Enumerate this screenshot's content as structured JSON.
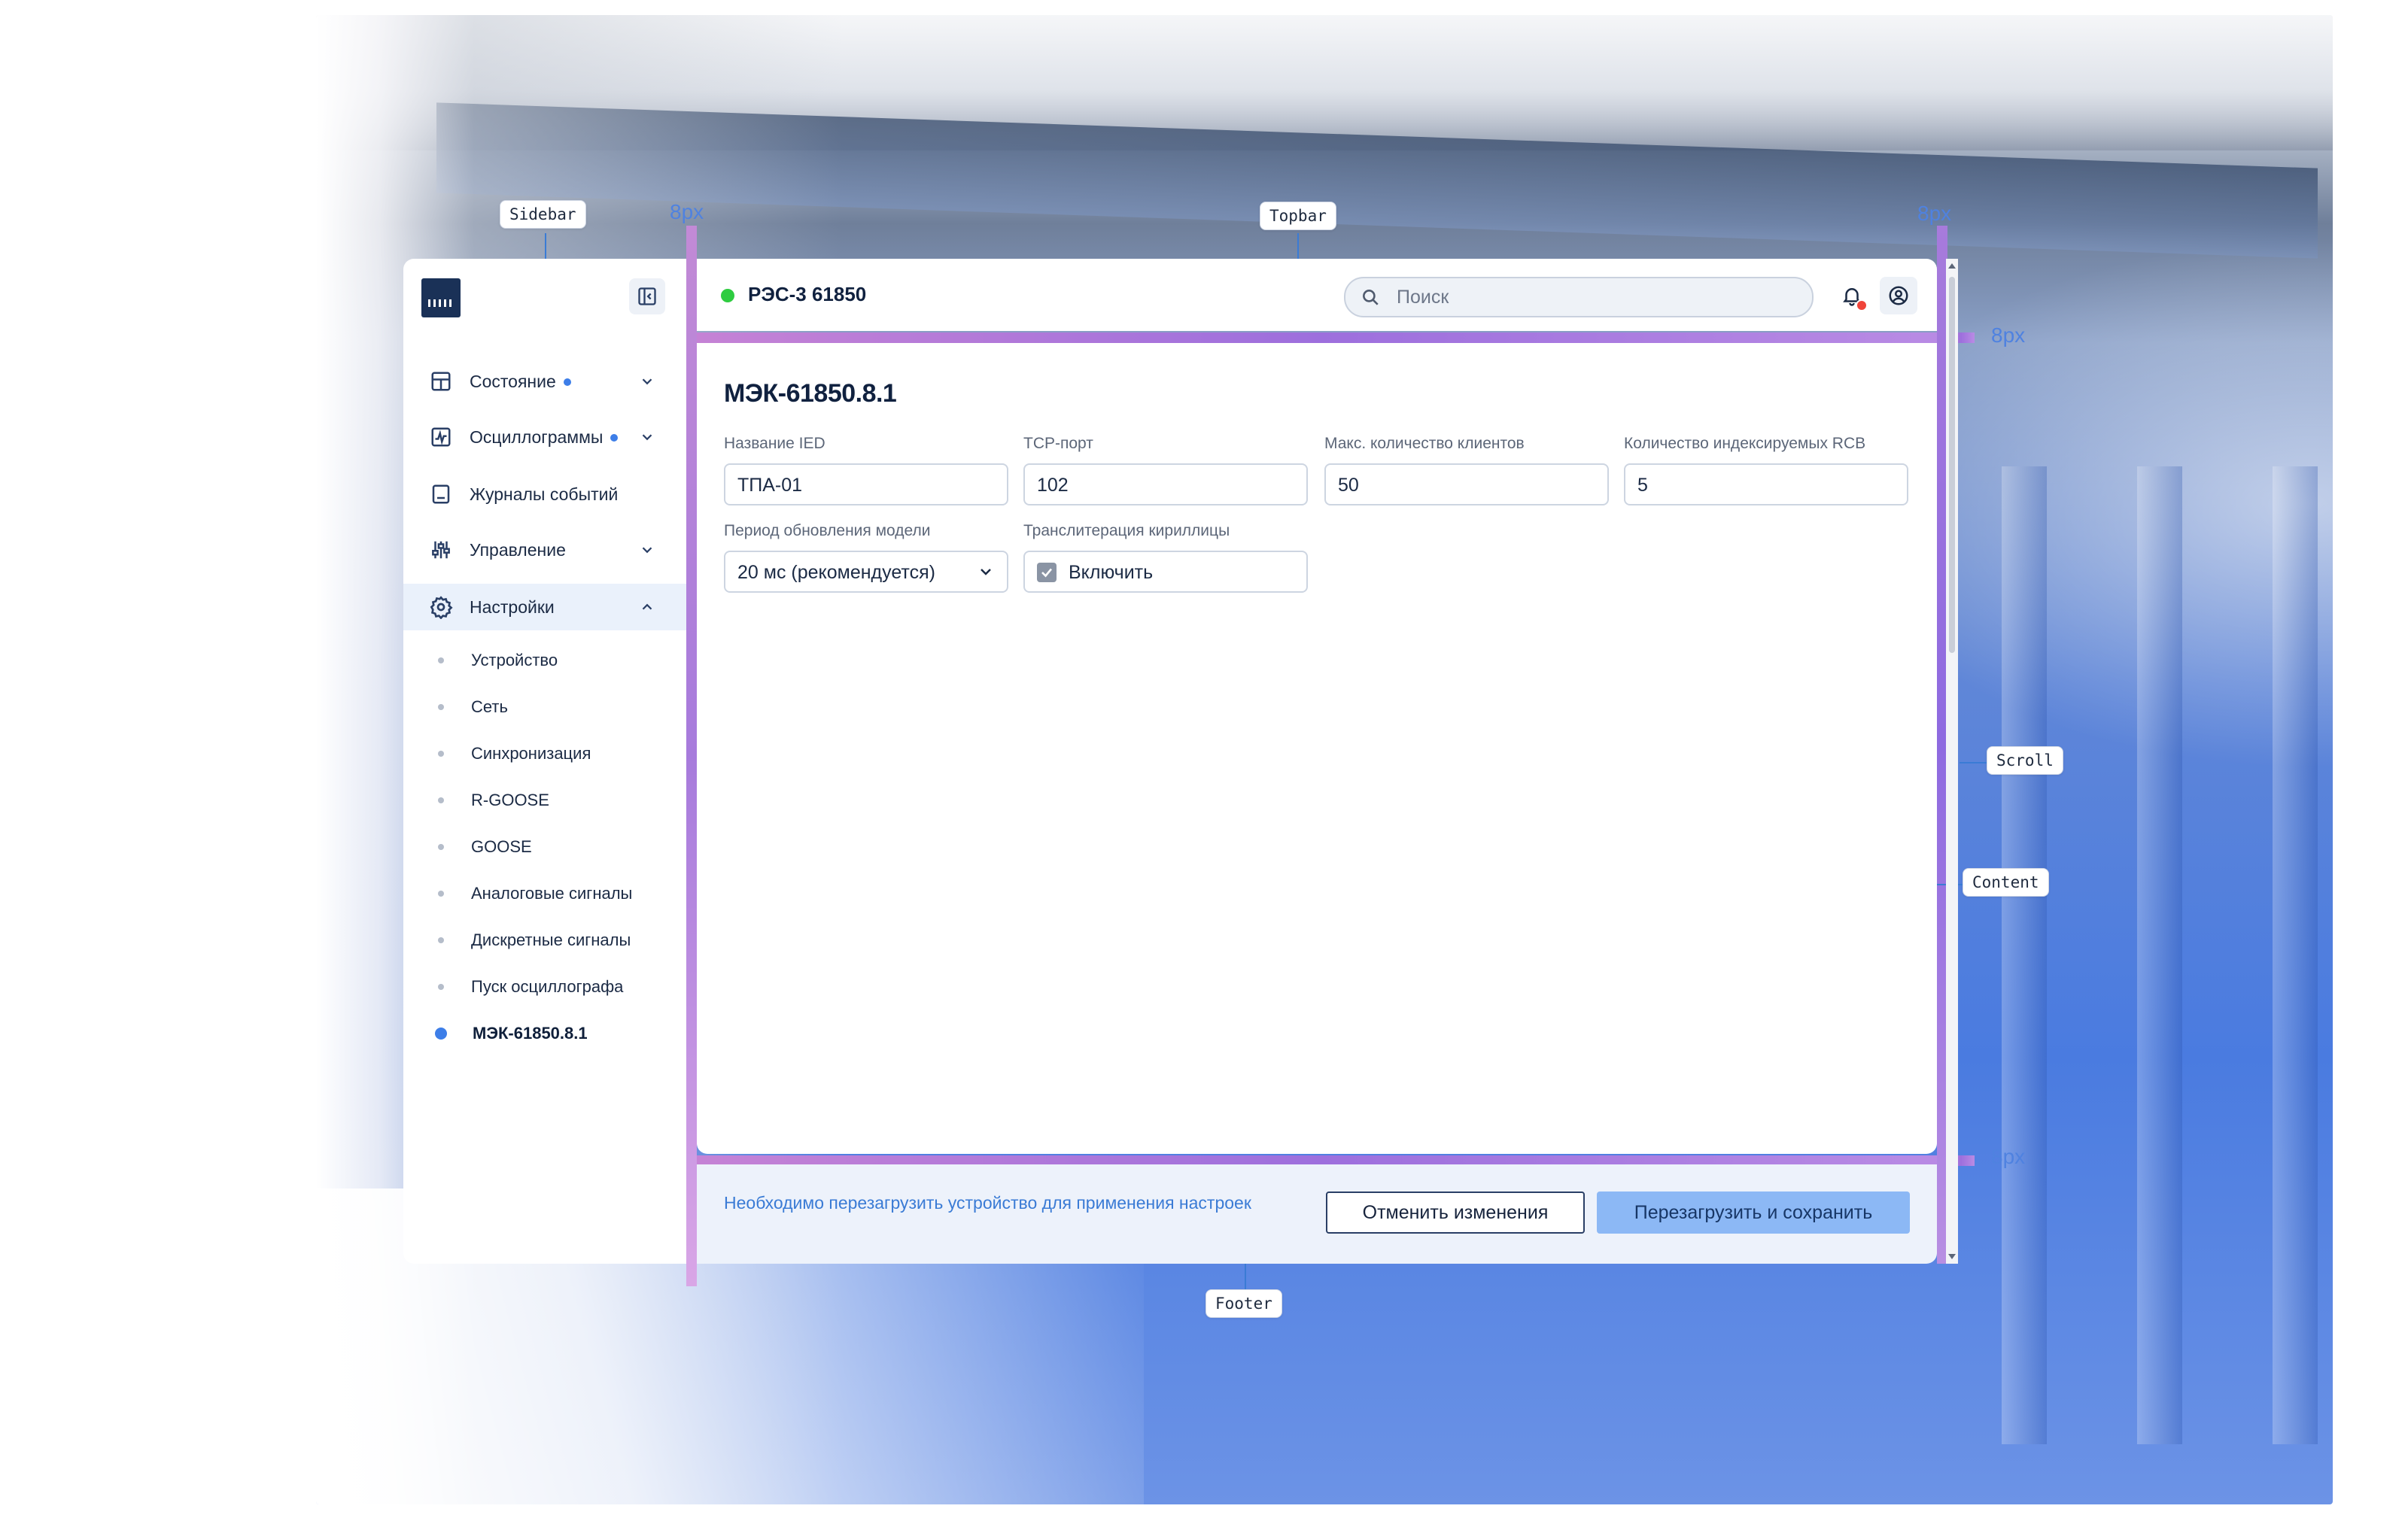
{
  "annotations": {
    "sidebar_tag": "Sidebar",
    "topbar_tag": "Topbar",
    "scroll_tag": "Scroll",
    "content_tag": "Content",
    "footer_tag": "Footer",
    "gap_label": "8px"
  },
  "topbar": {
    "device_name": "РЭС-3 61850",
    "status_color": "#2ecc40",
    "search_placeholder": "Поиск",
    "notification_badge_color": "#f0443a"
  },
  "sidebar": {
    "items": [
      {
        "label": "Состояние",
        "icon": "status-icon",
        "has_dot": true,
        "chevron": "down"
      },
      {
        "label": "Осциллограммы",
        "icon": "waveform-icon",
        "has_dot": true,
        "chevron": "down"
      },
      {
        "label": "Журналы событий",
        "icon": "log-icon",
        "has_dot": false,
        "chevron": null
      },
      {
        "label": "Управление",
        "icon": "sliders-icon",
        "has_dot": false,
        "chevron": "down"
      },
      {
        "label": "Настройки",
        "icon": "gear-icon",
        "has_dot": false,
        "chevron": "up",
        "active": true
      }
    ],
    "sub_items": [
      {
        "label": "Устройство"
      },
      {
        "label": "Сеть"
      },
      {
        "label": "Синхронизация"
      },
      {
        "label": "R-GOOSE"
      },
      {
        "label": "GOOSE"
      },
      {
        "label": "Аналоговые сигналы"
      },
      {
        "label": "Дискретные сигналы"
      },
      {
        "label": "Пуск осциллографа"
      },
      {
        "label": "МЭК-61850.8.1",
        "current": true
      }
    ]
  },
  "content": {
    "title": "МЭК-61850.8.1",
    "fields": [
      {
        "label": "Название IED",
        "value": "ТПА-01"
      },
      {
        "label": "TCP-порт",
        "value": "102"
      },
      {
        "label": "Макс. количество клиентов",
        "value": "50"
      },
      {
        "label": "Количество индексируемых RCB",
        "value": "5"
      }
    ],
    "model_period": {
      "label": "Период обновления модели",
      "value": "20 мс (рекомендуется)"
    },
    "transliteration": {
      "label": "Транслитерация кириллицы",
      "checkbox_label": "Включить",
      "checked": true
    }
  },
  "footer": {
    "message": "Необходимо перезагрузить устройство для применения настроек",
    "cancel_label": "Отменить изменения",
    "save_label": "Перезагрузить и сохранить"
  },
  "colors": {
    "accent": "#3d7ee8",
    "primary_button": "#8cb8f5",
    "dark_text": "#10213f"
  }
}
